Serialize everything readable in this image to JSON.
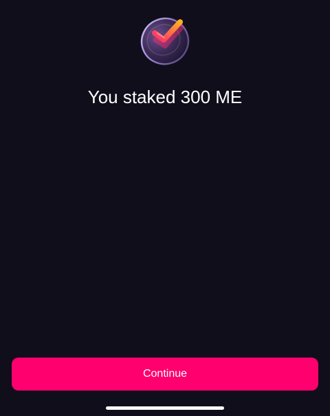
{
  "success": {
    "icon": "checkmark-badge-icon",
    "title": "You staked 300 ME"
  },
  "footer": {
    "continue_label": "Continue"
  },
  "colors": {
    "background": "#100e1a",
    "accent": "#ff006e",
    "check_start": "#ff2a6d",
    "check_end": "#ffb020"
  }
}
